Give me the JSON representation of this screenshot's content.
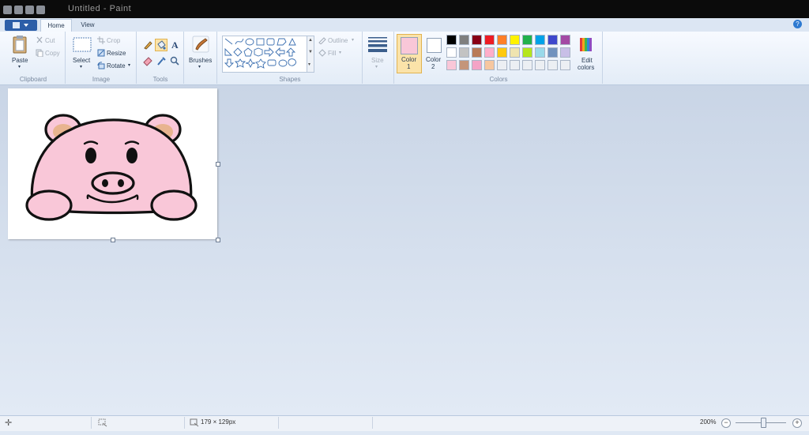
{
  "window": {
    "title": "Untitled - Paint"
  },
  "ribbon": {
    "tabs": [
      "Home",
      "View"
    ],
    "clipboard": {
      "group": "Clipboard",
      "paste": "Paste",
      "cut": "Cut",
      "copy": "Copy"
    },
    "image": {
      "group": "Image",
      "select": "Select",
      "crop": "Crop",
      "resize": "Resize",
      "rotate": "Rotate"
    },
    "tools": {
      "group": "Tools",
      "text_glyph": "A"
    },
    "brushes": {
      "label": "Brushes"
    },
    "shapes": {
      "group": "Shapes",
      "outline": "Outline",
      "fill": "Fill"
    },
    "size": {
      "label": "Size"
    },
    "colors": {
      "group": "Colors",
      "color1_label": "Color",
      "color1_num": "1",
      "color2_label": "Color",
      "color2_num": "2",
      "edit_label": "Edit",
      "edit_label2": "colors",
      "color1": "#f9c7d8",
      "color2": "#ffffff",
      "palette": [
        [
          "#000000",
          "#7f7f7f",
          "#880015",
          "#ed1c24",
          "#ff7f27",
          "#fff200",
          "#22b14c",
          "#00a2e8",
          "#3f48cc",
          "#a349a4"
        ],
        [
          "#ffffff",
          "#c3c3c3",
          "#b97a57",
          "#ffaec9",
          "#ffc90e",
          "#efe4b0",
          "#b5e61d",
          "#99d9ea",
          "#7092be",
          "#c8bfe7"
        ],
        [
          "#f9c7d8",
          "#c4957a",
          "#f4a3c6",
          "#f6c7a0",
          "#eceff3",
          "#eceff3",
          "#eceff3",
          "#eceff3",
          "#eceff3",
          "#eceff3"
        ]
      ]
    }
  },
  "status": {
    "size": "179 × 129px",
    "zoom": "200%"
  },
  "icons": [
    "paste-icon",
    "cut-icon",
    "copy-icon",
    "select-icon",
    "crop-icon",
    "resize-icon",
    "rotate-icon",
    "pencil-icon",
    "fill-icon",
    "text-icon",
    "eraser-icon",
    "color-picker-icon",
    "magnifier-icon",
    "brushes-icon",
    "size-icon",
    "edit-colors-icon",
    "zoom-out-icon",
    "zoom-in-icon"
  ]
}
